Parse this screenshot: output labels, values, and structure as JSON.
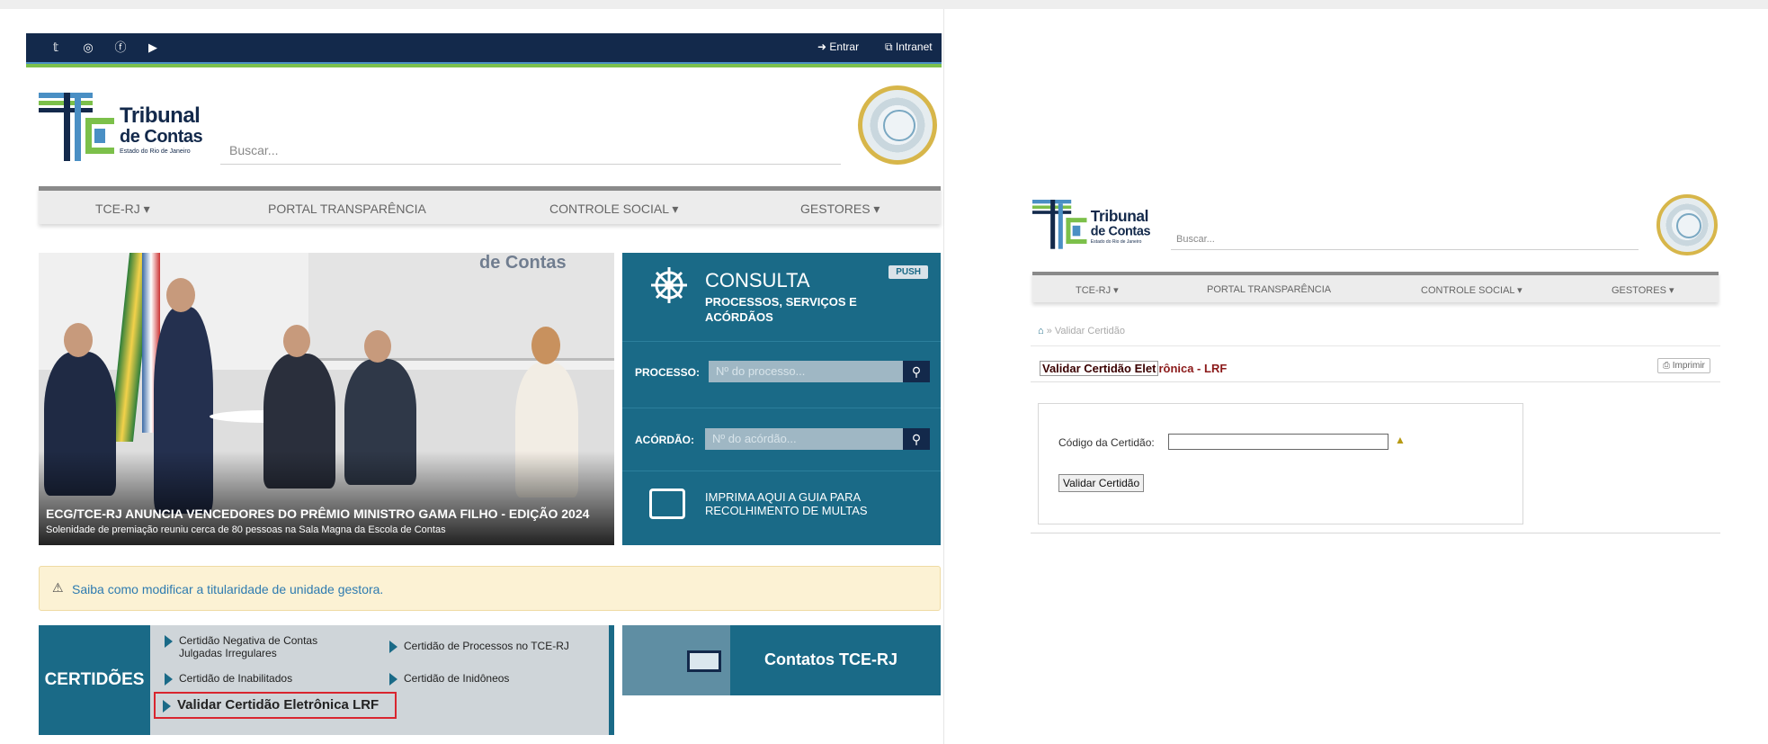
{
  "left_page": {
    "social": {
      "icons": [
        "twitter-icon",
        "instagram-icon",
        "facebook-icon",
        "youtube-icon"
      ],
      "entrar": "Entrar",
      "intranet": "Intranet"
    },
    "logo": {
      "line1": "Tribunal",
      "line2": "de Contas",
      "line3": "Estado do Rio de Janeiro"
    },
    "search_placeholder": "Buscar...",
    "nav": [
      "TCE-RJ ▾",
      "PORTAL TRANSPARÊNCIA",
      "CONTROLE SOCIAL ▾",
      "GESTORES ▾"
    ],
    "hero": {
      "brand_text": "de Contas",
      "headline": "ECG/TCE-RJ ANUNCIA VENCEDORES DO PRÊMIO MINISTRO GAMA FILHO - EDIÇÃO 2024",
      "subline": "Solenidade de premiação reuniu cerca de 80 pessoas na Sala Magna da Escola de Contas"
    },
    "consulta": {
      "title": "CONSULTA",
      "subtitle": "PROCESSOS, SERVIÇOS E ACÓRDÃOS",
      "badge": "PUSH",
      "processo_label": "PROCESSO:",
      "processo_placeholder": "Nº do processo...",
      "acordao_label": "ACÓRDÃO:",
      "acordao_placeholder": "Nº do acórdão...",
      "print_text": "IMPRIMA AQUI A GUIA PARA RECOLHIMENTO DE MULTAS"
    },
    "alert": {
      "icon": "⚠",
      "text": "Saiba como modificar a titularidade de unidade gestora."
    },
    "certidoes": {
      "label": "CERTIDÕES",
      "items": [
        "Certidão Negativa de Contas Julgadas Irregulares",
        "Certidão de Processos no TCE-RJ",
        "Certidão de Inabilitados",
        "Certidão de Inidôneos",
        "Validar Certidão Eletrônica LRF"
      ]
    },
    "contatos": "Contatos TCE-RJ",
    "colors": {
      "navy": "#13294b",
      "teal": "#1a6a87",
      "green": "#7cc04a",
      "highlight": "#d9252f"
    }
  },
  "right_page": {
    "logo": {
      "line1": "Tribunal",
      "line2": "de Contas",
      "line3": "Estado do Rio de Janeiro"
    },
    "search_placeholder": "Buscar...",
    "nav": [
      "TCE-RJ ▾",
      "PORTAL TRANSPARÊNCIA",
      "CONTROLE SOCIAL ▾",
      "GESTORES ▾"
    ],
    "breadcrumb": "Validar Certidão",
    "title_boxed": "Validar Certidão Elet",
    "title_rest": "rônica - LRF",
    "print_button": "Imprimir",
    "code_label": "Código da Certidão:",
    "code_value": "",
    "submit_button": "Validar Certidão"
  }
}
